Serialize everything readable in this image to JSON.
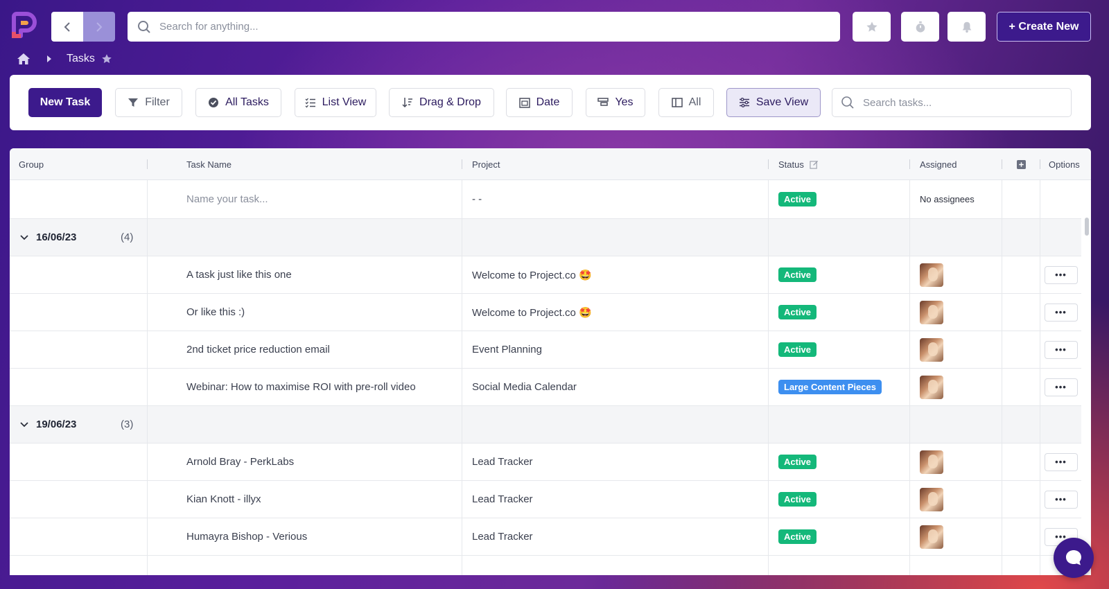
{
  "topbar": {
    "search_placeholder": "Search for anything...",
    "create_label": "+ Create New"
  },
  "breadcrumb": {
    "current": "Tasks"
  },
  "toolbar": {
    "new_task": "New Task",
    "filter": "Filter",
    "all_tasks": "All Tasks",
    "list_view": "List View",
    "drag_drop": "Drag & Drop",
    "date": "Date",
    "yes": "Yes",
    "all": "All",
    "save_view": "Save View",
    "search_placeholder": "Search tasks..."
  },
  "table": {
    "columns": {
      "group": "Group",
      "task_name": "Task Name",
      "project": "Project",
      "status": "Status",
      "assigned": "Assigned",
      "options": "Options"
    },
    "new_row": {
      "name_placeholder": "Name your task...",
      "project": "- -",
      "status": "Active",
      "assigned": "No assignees"
    },
    "groups": [
      {
        "date": "16/06/23",
        "count": "(4)",
        "tasks": [
          {
            "name": "A task just like this one",
            "project": "Welcome to Project.co 🤩",
            "status": "Active",
            "status_type": "active"
          },
          {
            "name": "Or like this :)",
            "project": "Welcome to Project.co 🤩",
            "status": "Active",
            "status_type": "active"
          },
          {
            "name": "2nd ticket price reduction email",
            "project": "Event Planning",
            "status": "Active",
            "status_type": "active"
          },
          {
            "name": "Webinar: How to maximise ROI with pre-roll video",
            "project": "Social Media Calendar",
            "status": "Large Content Pieces",
            "status_type": "content"
          }
        ]
      },
      {
        "date": "19/06/23",
        "count": "(3)",
        "tasks": [
          {
            "name": "Arnold Bray - PerkLabs",
            "project": "Lead Tracker",
            "status": "Active",
            "status_type": "active"
          },
          {
            "name": "Kian Knott - illyx",
            "project": "Lead Tracker",
            "status": "Active",
            "status_type": "active"
          },
          {
            "name": "Humayra Bishop - Verious",
            "project": "Lead Tracker",
            "status": "Active",
            "status_type": "active"
          }
        ]
      }
    ],
    "options_glyph": "•••"
  },
  "colors": {
    "brand": "#3c1a8c",
    "active": "#14b87a",
    "content": "#3d8ff0"
  }
}
